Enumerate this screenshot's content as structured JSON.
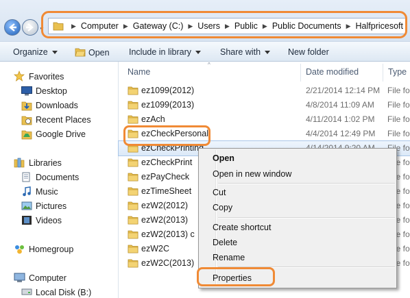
{
  "address": {
    "breadcrumbs": [
      "Computer",
      "Gateway (C:)",
      "Users",
      "Public",
      "Public Documents",
      "Halfpricesoft"
    ]
  },
  "toolbar": {
    "organize": "Organize",
    "open": "Open",
    "include_in_library": "Include in library",
    "share_with": "Share with",
    "new_folder": "New folder"
  },
  "nav": {
    "favorites": "Favorites",
    "favorites_items": [
      "Desktop",
      "Downloads",
      "Recent Places",
      "Google Drive"
    ],
    "libraries": "Libraries",
    "libraries_items": [
      "Documents",
      "Music",
      "Pictures",
      "Videos"
    ],
    "homegroup": "Homegroup",
    "computer": "Computer",
    "computer_items": [
      "Local Disk (B:)"
    ]
  },
  "columns": {
    "name": "Name",
    "date_modified": "Date modified",
    "type": "Type"
  },
  "files": [
    {
      "name": "ez1099(2012)",
      "date": "2/21/2014 12:14 PM",
      "type": "File fo"
    },
    {
      "name": "ez1099(2013)",
      "date": "4/8/2014 11:09 AM",
      "type": "File fo"
    },
    {
      "name": "ezAch",
      "date": "4/11/2014 1:02 PM",
      "type": "File fo"
    },
    {
      "name": "ezCheckPersonal",
      "date": "4/4/2014 12:49 PM",
      "type": "File fo"
    },
    {
      "name": "ezCheckPrinting",
      "date": "4/14/2014 9:20 AM",
      "type": "File fo"
    },
    {
      "name": "ezCheckPrint",
      "date": "",
      "type": "File fo"
    },
    {
      "name": "ezPayCheck",
      "date": "",
      "type": "File fo"
    },
    {
      "name": "ezTimeSheet",
      "date": "",
      "type": "File fo"
    },
    {
      "name": "ezW2(2012)",
      "date": "",
      "type": "File fo"
    },
    {
      "name": "ezW2(2013)",
      "date": "",
      "type": "File fo"
    },
    {
      "name": "ezW2(2013) c",
      "date": "",
      "type": "File fo"
    },
    {
      "name": "ezW2C",
      "date": "",
      "type": "File fo"
    },
    {
      "name": "ezW2C(2013)",
      "date": "",
      "type": "File fo"
    }
  ],
  "context_menu": {
    "open": "Open",
    "open_new_window": "Open in new window",
    "cut": "Cut",
    "copy": "Copy",
    "create_shortcut": "Create shortcut",
    "delete": "Delete",
    "rename": "Rename",
    "properties": "Properties"
  },
  "colors": {
    "highlight": "#f08a35",
    "folder": "#e9c04f"
  }
}
